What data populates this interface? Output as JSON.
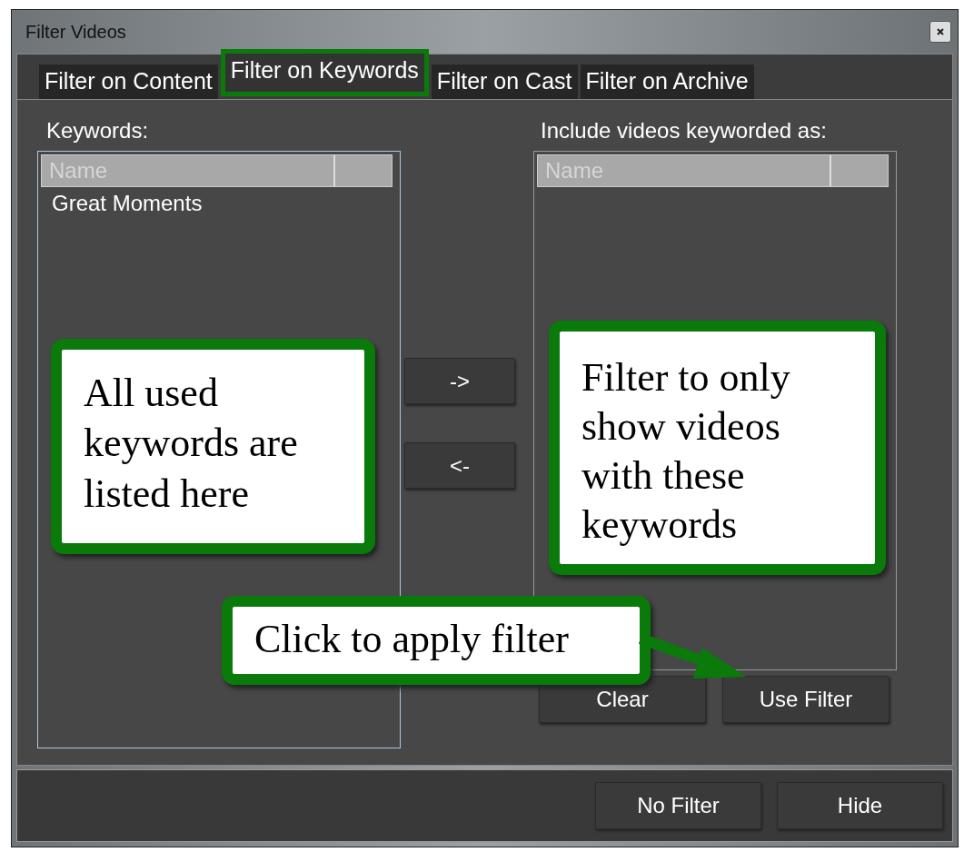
{
  "window": {
    "title": "Filter Videos"
  },
  "tabs": [
    {
      "label": "Filter on Content",
      "selected": false
    },
    {
      "label": "Filter on Keywords",
      "selected": true
    },
    {
      "label": "Filter on Cast",
      "selected": false
    },
    {
      "label": "Filter on Archive",
      "selected": false
    }
  ],
  "keywords": {
    "label": "Keywords:",
    "column": "Name",
    "items": [
      "Great Moments"
    ]
  },
  "move_buttons": [
    "->",
    "<-"
  ],
  "included": {
    "label": "Include videos keyworded as:",
    "column": "Name"
  },
  "list_buttons": [
    "Clear",
    "Use Filter"
  ],
  "footer_buttons": [
    "No Filter",
    "Hide"
  ],
  "callouts": [
    {
      "kind": "left",
      "text": "All used keywords are listed here"
    },
    {
      "kind": "right",
      "text": "Filter to only show videos with these keywords"
    },
    {
      "kind": "bottom",
      "text": "Click to apply filter"
    }
  ]
}
